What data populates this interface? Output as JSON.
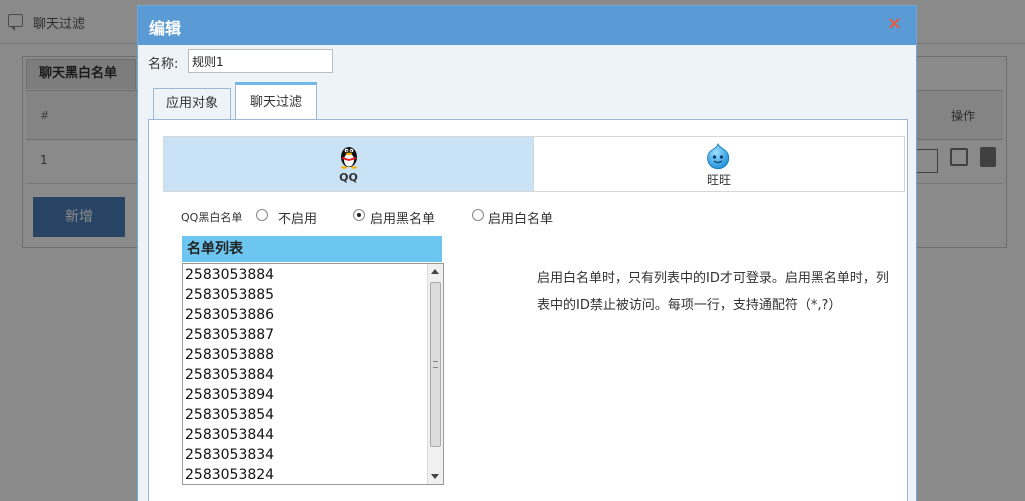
{
  "background": {
    "header_title": "聊天过滤",
    "tab_label": "聊天黑白名单",
    "table_hash": "#",
    "table_op": "操作",
    "row_index": "1",
    "add_button": "新增"
  },
  "modal": {
    "title": "编辑",
    "close": "×",
    "name_label": "名称:",
    "name_value": "规则1",
    "tabs": [
      {
        "label": "应用对象"
      },
      {
        "label": "聊天过滤"
      }
    ],
    "segments": [
      {
        "label": "QQ",
        "icon": "qq-penguin-icon"
      },
      {
        "label": "旺旺",
        "icon": "wangwang-icon"
      }
    ],
    "radio_group_label": "QQ黑白名单",
    "radios": [
      {
        "label": "不启用",
        "checked": false
      },
      {
        "label": "启用黑名单",
        "checked": true
      },
      {
        "label": "启用白名单",
        "checked": false
      }
    ],
    "list_title": "名单列表",
    "list_items": [
      "2583053884",
      "2583053885",
      "2583053886",
      "2583053887",
      "2583053888",
      "2583053884",
      "2583053894",
      "2583053854",
      "2583053844",
      "2583053834",
      "2583053824"
    ],
    "help_text": "启用白名单时，只有列表中的ID才可登录。启用黑名单时，列表中的ID禁止被访问。每项一行，支持通配符（*,?）"
  },
  "colors": {
    "header_blue": "#5b9bd5",
    "close_red": "#e25b45",
    "list_header": "#6cc6f0",
    "selected_segment": "#c9e2f6"
  }
}
